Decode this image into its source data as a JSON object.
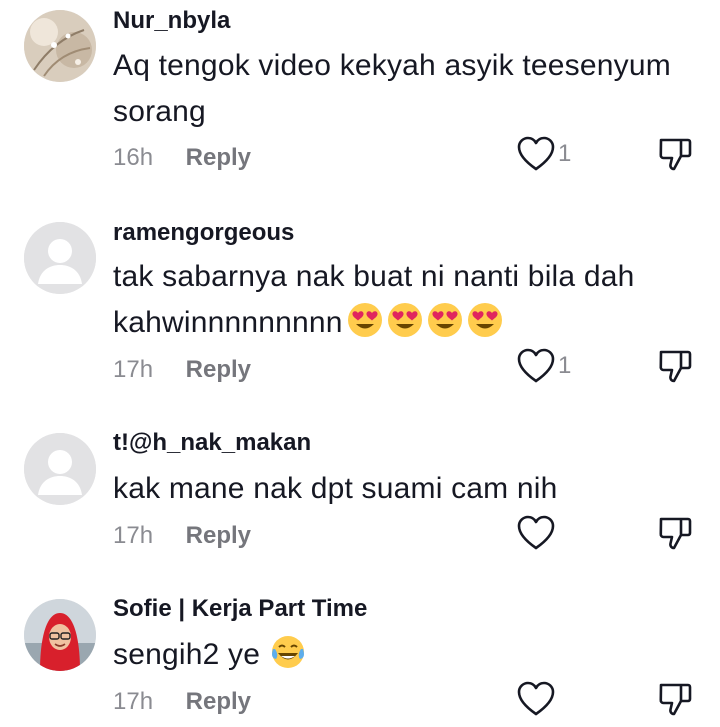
{
  "comments": [
    {
      "username": "Nur_nbyla",
      "text": "Aq tengok video kekyah asyik teesenyum sorang",
      "emojis": [],
      "time": "16h",
      "reply_label": "Reply",
      "likes": "1",
      "avatar": "photo"
    },
    {
      "username": "ramengorgeous",
      "text": "tak sabarnya nak buat ni nanti bila dah kahwinnnnnnnnn",
      "emojis": [
        "heart-eyes",
        "heart-eyes",
        "heart-eyes",
        "heart-eyes"
      ],
      "time": "17h",
      "reply_label": "Reply",
      "likes": "1",
      "avatar": "default"
    },
    {
      "username": "t!@h_nak_makan",
      "text": "kak mane nak dpt suami cam nih",
      "emojis": [],
      "time": "17h",
      "reply_label": "Reply",
      "likes": "",
      "avatar": "default"
    },
    {
      "username": "Sofie | Kerja Part Time",
      "text": "sengih2 ye",
      "emojis": [
        "tears-of-joy"
      ],
      "time": "17h",
      "reply_label": "Reply",
      "likes": "",
      "avatar": "photo"
    }
  ],
  "icons": {
    "like": "heart-outline-icon",
    "dislike": "thumbs-down-icon"
  },
  "colors": {
    "text": "#161823",
    "meta": "#8a8b91",
    "icon": "#161823"
  }
}
